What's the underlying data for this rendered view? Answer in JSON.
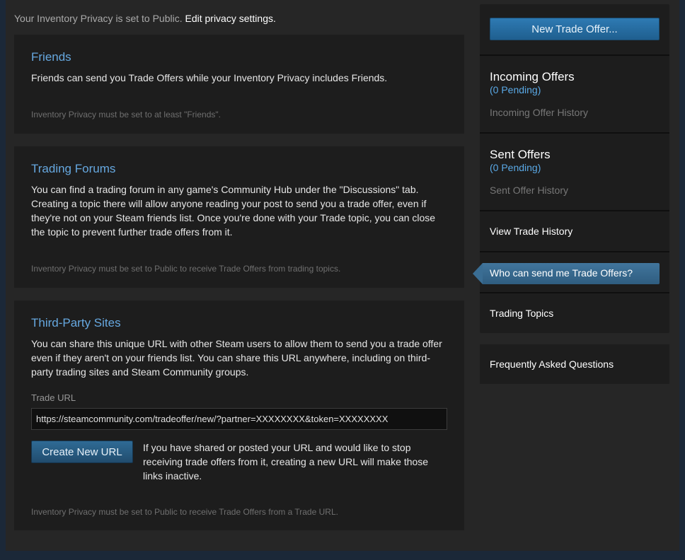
{
  "privacy_notice": {
    "text": "Your Inventory Privacy is set to Public.",
    "link": "Edit privacy settings."
  },
  "panels": {
    "friends": {
      "title": "Friends",
      "body": "Friends can send you Trade Offers while your Inventory Privacy includes Friends.",
      "note": "Inventory Privacy must be set to at least \"Friends\"."
    },
    "forums": {
      "title": "Trading Forums",
      "body": "You can find a trading forum in any game's Community Hub under the \"Discussions\" tab. Creating a topic there will allow anyone reading your post to send you a trade offer, even if they're not on your Steam friends list. Once you're done with your Trade topic, you can close the topic to prevent further trade offers from it.",
      "note": "Inventory Privacy must be set to Public to receive Trade Offers from trading topics."
    },
    "thirdparty": {
      "title": "Third-Party Sites",
      "body": "You can share this unique URL with other Steam users to allow them to send you a trade offer even if they aren't on your friends list. You can share this URL anywhere, including on third-party trading sites and Steam Community groups.",
      "trade_url_label": "Trade URL",
      "trade_url_value": "https://steamcommunity.com/tradeoffer/new/?partner=XXXXXXXX&token=XXXXXXXX",
      "create_button": "Create New URL",
      "create_desc": "If you have shared or posted your URL and would like to stop receiving trade offers from it, creating a new URL will make those links inactive.",
      "note": "Inventory Privacy must be set to Public to receive Trade Offers from a Trade URL."
    }
  },
  "sidebar": {
    "new_offer_button": "New Trade Offer...",
    "incoming": {
      "title": "Incoming Offers",
      "pending": "(0 Pending)",
      "history": "Incoming Offer History"
    },
    "sent": {
      "title": "Sent Offers",
      "pending": "(0 Pending)",
      "history": "Sent Offer History"
    },
    "view_history": "View Trade History",
    "who_can_send": "Who can send me Trade Offers?",
    "trading_topics": "Trading Topics",
    "faq": "Frequently Asked Questions"
  },
  "colors": {
    "accent_blue": "#66a8e0",
    "pending_blue": "#5aa9e6",
    "button_blue": "#2e7ab3"
  }
}
